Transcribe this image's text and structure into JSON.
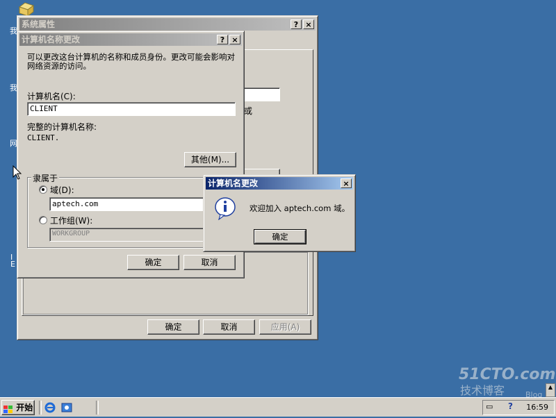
{
  "desktop": {
    "left_icon_glyphs": [
      "我",
      "我",
      "网",
      "I",
      "E"
    ]
  },
  "system_properties": {
    "title": "系统属性",
    "help_btn": "?",
    "close_btn": "×",
    "ok": "确定",
    "cancel": "取消",
    "apply": "应用(A)",
    "partial_text": "或"
  },
  "name_change_dialog": {
    "title": "计算机名称更改",
    "help_btn": "?",
    "close_btn": "×",
    "description": "可以更改这台计算机的名称和成员身份。更改可能会影响对网络资源的访问。",
    "computer_name_label": "计算机名(C):",
    "computer_name_value": "CLIENT",
    "full_name_label": "完整的计算机名称:",
    "full_name_value": "CLIENT.",
    "more_button": "其他(M)...",
    "member_of_label": "隶属于",
    "domain_label": "域(D):",
    "domain_value": "aptech.com",
    "workgroup_label": "工作组(W):",
    "workgroup_value": "WORKGROUP",
    "ok": "确定",
    "cancel": "取消"
  },
  "message_box": {
    "title": "计算机名更改",
    "close_btn": "×",
    "message": "欢迎加入 aptech.com 域。",
    "ok": "确定"
  },
  "taskbar": {
    "start_label": "开始",
    "clock": "16:59"
  },
  "watermark": {
    "line1": "51CTO.com",
    "line2": "技术博客",
    "line3": "Blog"
  }
}
